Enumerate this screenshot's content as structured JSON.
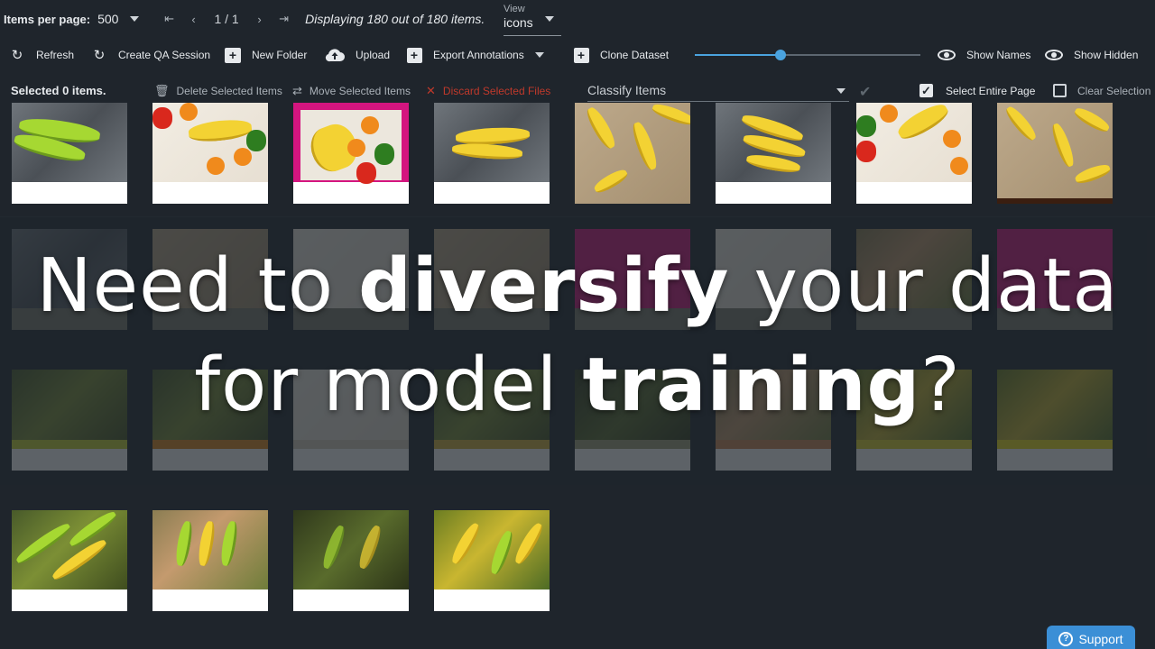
{
  "topbar": {
    "items_per_page_label": "Items per page:",
    "items_per_page_value": "500",
    "first_icon": "⇤",
    "prev_icon": "‹",
    "page": "1 / 1",
    "next_icon": "›",
    "last_icon": "⇥",
    "display_text": "Displaying 180 out of 180 items.",
    "view_label": "View",
    "view_value": "icons"
  },
  "toolbar": {
    "refresh": "Refresh",
    "create_qa": "Create QA Session",
    "new_folder": "New Folder",
    "upload": "Upload",
    "export": "Export Annotations",
    "clone": "Clone Dataset",
    "zoom_fraction": 0.38,
    "show_names": "Show Names",
    "show_hidden": "Show Hidden"
  },
  "selection": {
    "count_text": "Selected 0 items.",
    "delete": "Delete Selected Items",
    "move": "Move Selected Items",
    "discard": "Discard Selected Files",
    "classify": "Classify Items",
    "select_page": "Select Entire Page",
    "clear": "Clear Selection"
  },
  "overlay": {
    "line1_a": "Need to ",
    "line1_b": "diversify",
    "line1_c": " your data",
    "line2_a": "for model ",
    "line2_b": "training",
    "line2_c": "?"
  },
  "support": {
    "label": "Support",
    "icon": "?"
  },
  "colors": {
    "background": "#1f252c",
    "accent": "#3b8fd6",
    "danger": "#c0392b"
  }
}
